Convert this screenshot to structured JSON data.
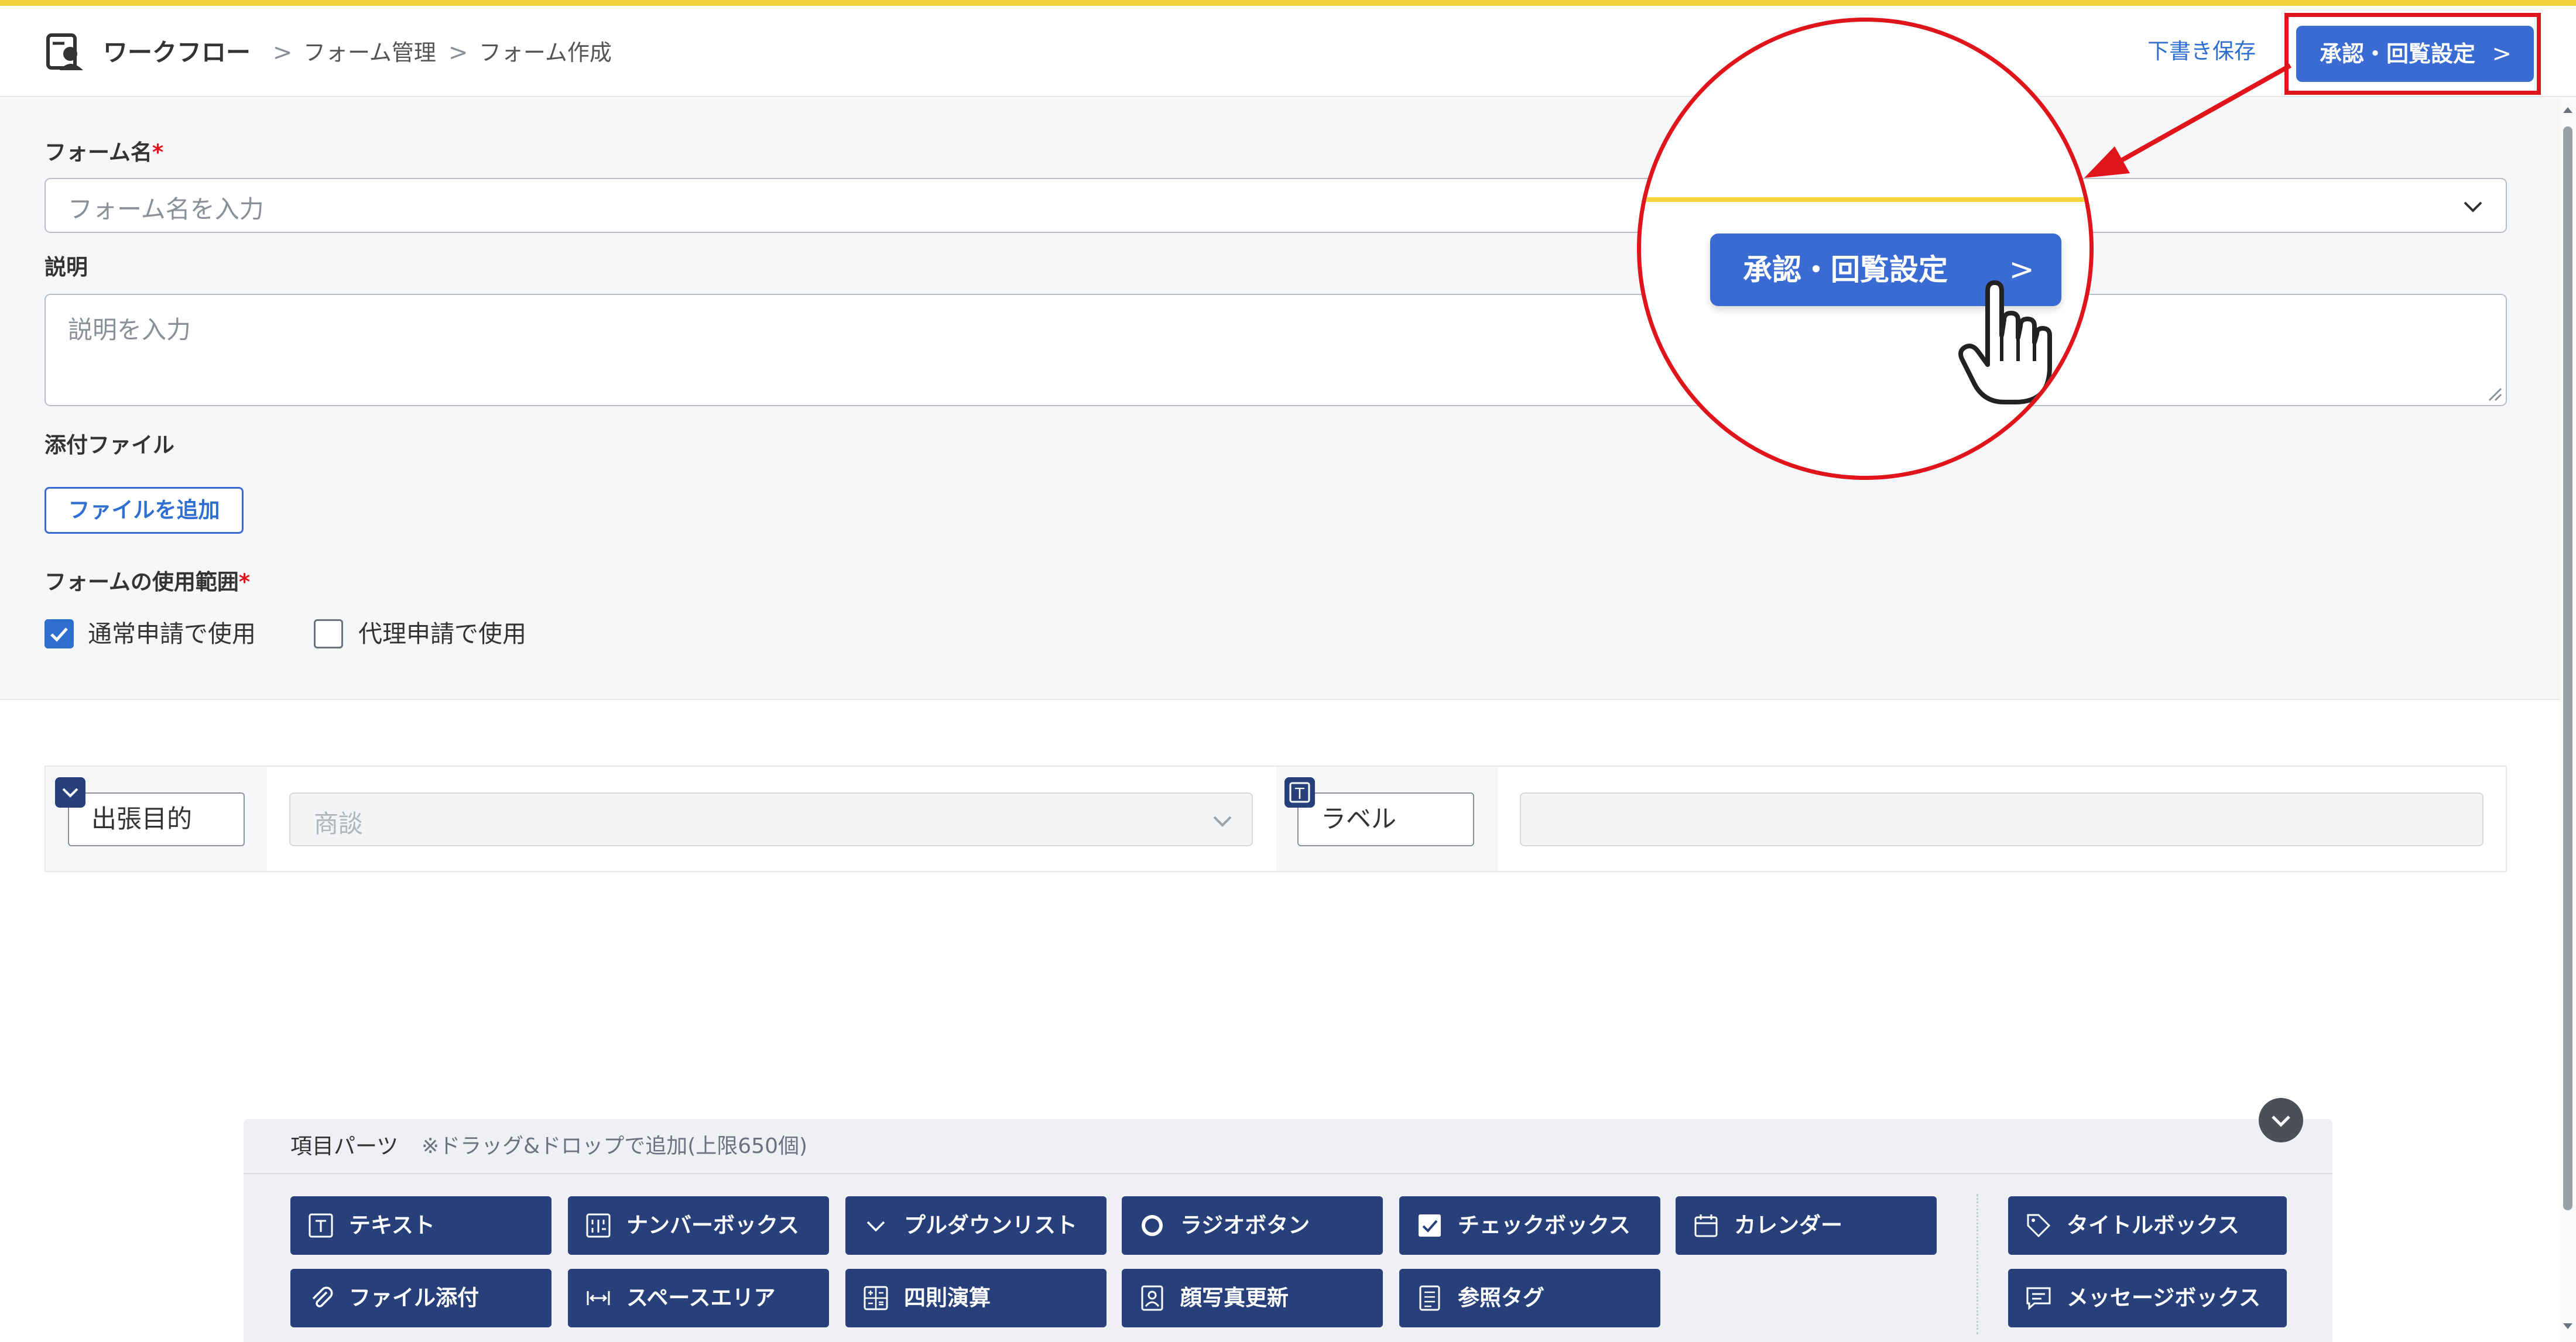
{
  "header": {
    "app_name": "ワークフロー",
    "breadcrumb": [
      "フォーム管理",
      "フォーム作成"
    ],
    "separator": ">",
    "draft_save": "下書き保存",
    "approval_button": "承認・回覧設定",
    "approval_chevron": ">"
  },
  "form": {
    "name_label": "フォーム名",
    "required_mark": "*",
    "name_placeholder": "フォーム名を入力",
    "description_label": "説明",
    "description_placeholder": "説明を入力",
    "attachment_label": "添付ファイル",
    "add_file_button": "ファイルを追加",
    "scope_label": "フォームの使用範囲",
    "scope_options": [
      {
        "label": "通常申請で使用",
        "checked": true
      },
      {
        "label": "代理申請で使用",
        "checked": false
      }
    ]
  },
  "items_row": {
    "item1_label": "出張目的",
    "item1_value": "商談",
    "item2_label": "ラベル",
    "item2_badge": "T"
  },
  "parts_panel": {
    "title": "項目パーツ",
    "note": "※ドラッグ&ドロップで追加(上限650個)",
    "buttons": [
      {
        "label": "テキスト",
        "icon": "text-icon"
      },
      {
        "label": "ナンバーボックス",
        "icon": "number-icon"
      },
      {
        "label": "プルダウンリスト",
        "icon": "chevron-down-icon"
      },
      {
        "label": "ラジオボタン",
        "icon": "radio-icon"
      },
      {
        "label": "チェックボックス",
        "icon": "checkbox-icon"
      },
      {
        "label": "カレンダー",
        "icon": "calendar-icon"
      },
      {
        "label": "タイトルボックス",
        "icon": "tag-icon"
      },
      {
        "label": "ファイル添付",
        "icon": "paperclip-icon"
      },
      {
        "label": "スペースエリア",
        "icon": "space-icon"
      },
      {
        "label": "四則演算",
        "icon": "calculator-icon"
      },
      {
        "label": "顔写真更新",
        "icon": "portrait-icon"
      },
      {
        "label": "参照タグ",
        "icon": "list-icon"
      },
      {
        "label": "メッセージボックス",
        "icon": "message-icon"
      }
    ]
  },
  "zoom_callout": {
    "button_label": "承認・回覧設定",
    "chevron": ">"
  },
  "colors": {
    "accent_blue": "#3a6bd3",
    "dark_navy": "#27407a",
    "highlight_red": "#e0141b",
    "top_yellow": "#f5d33a"
  }
}
